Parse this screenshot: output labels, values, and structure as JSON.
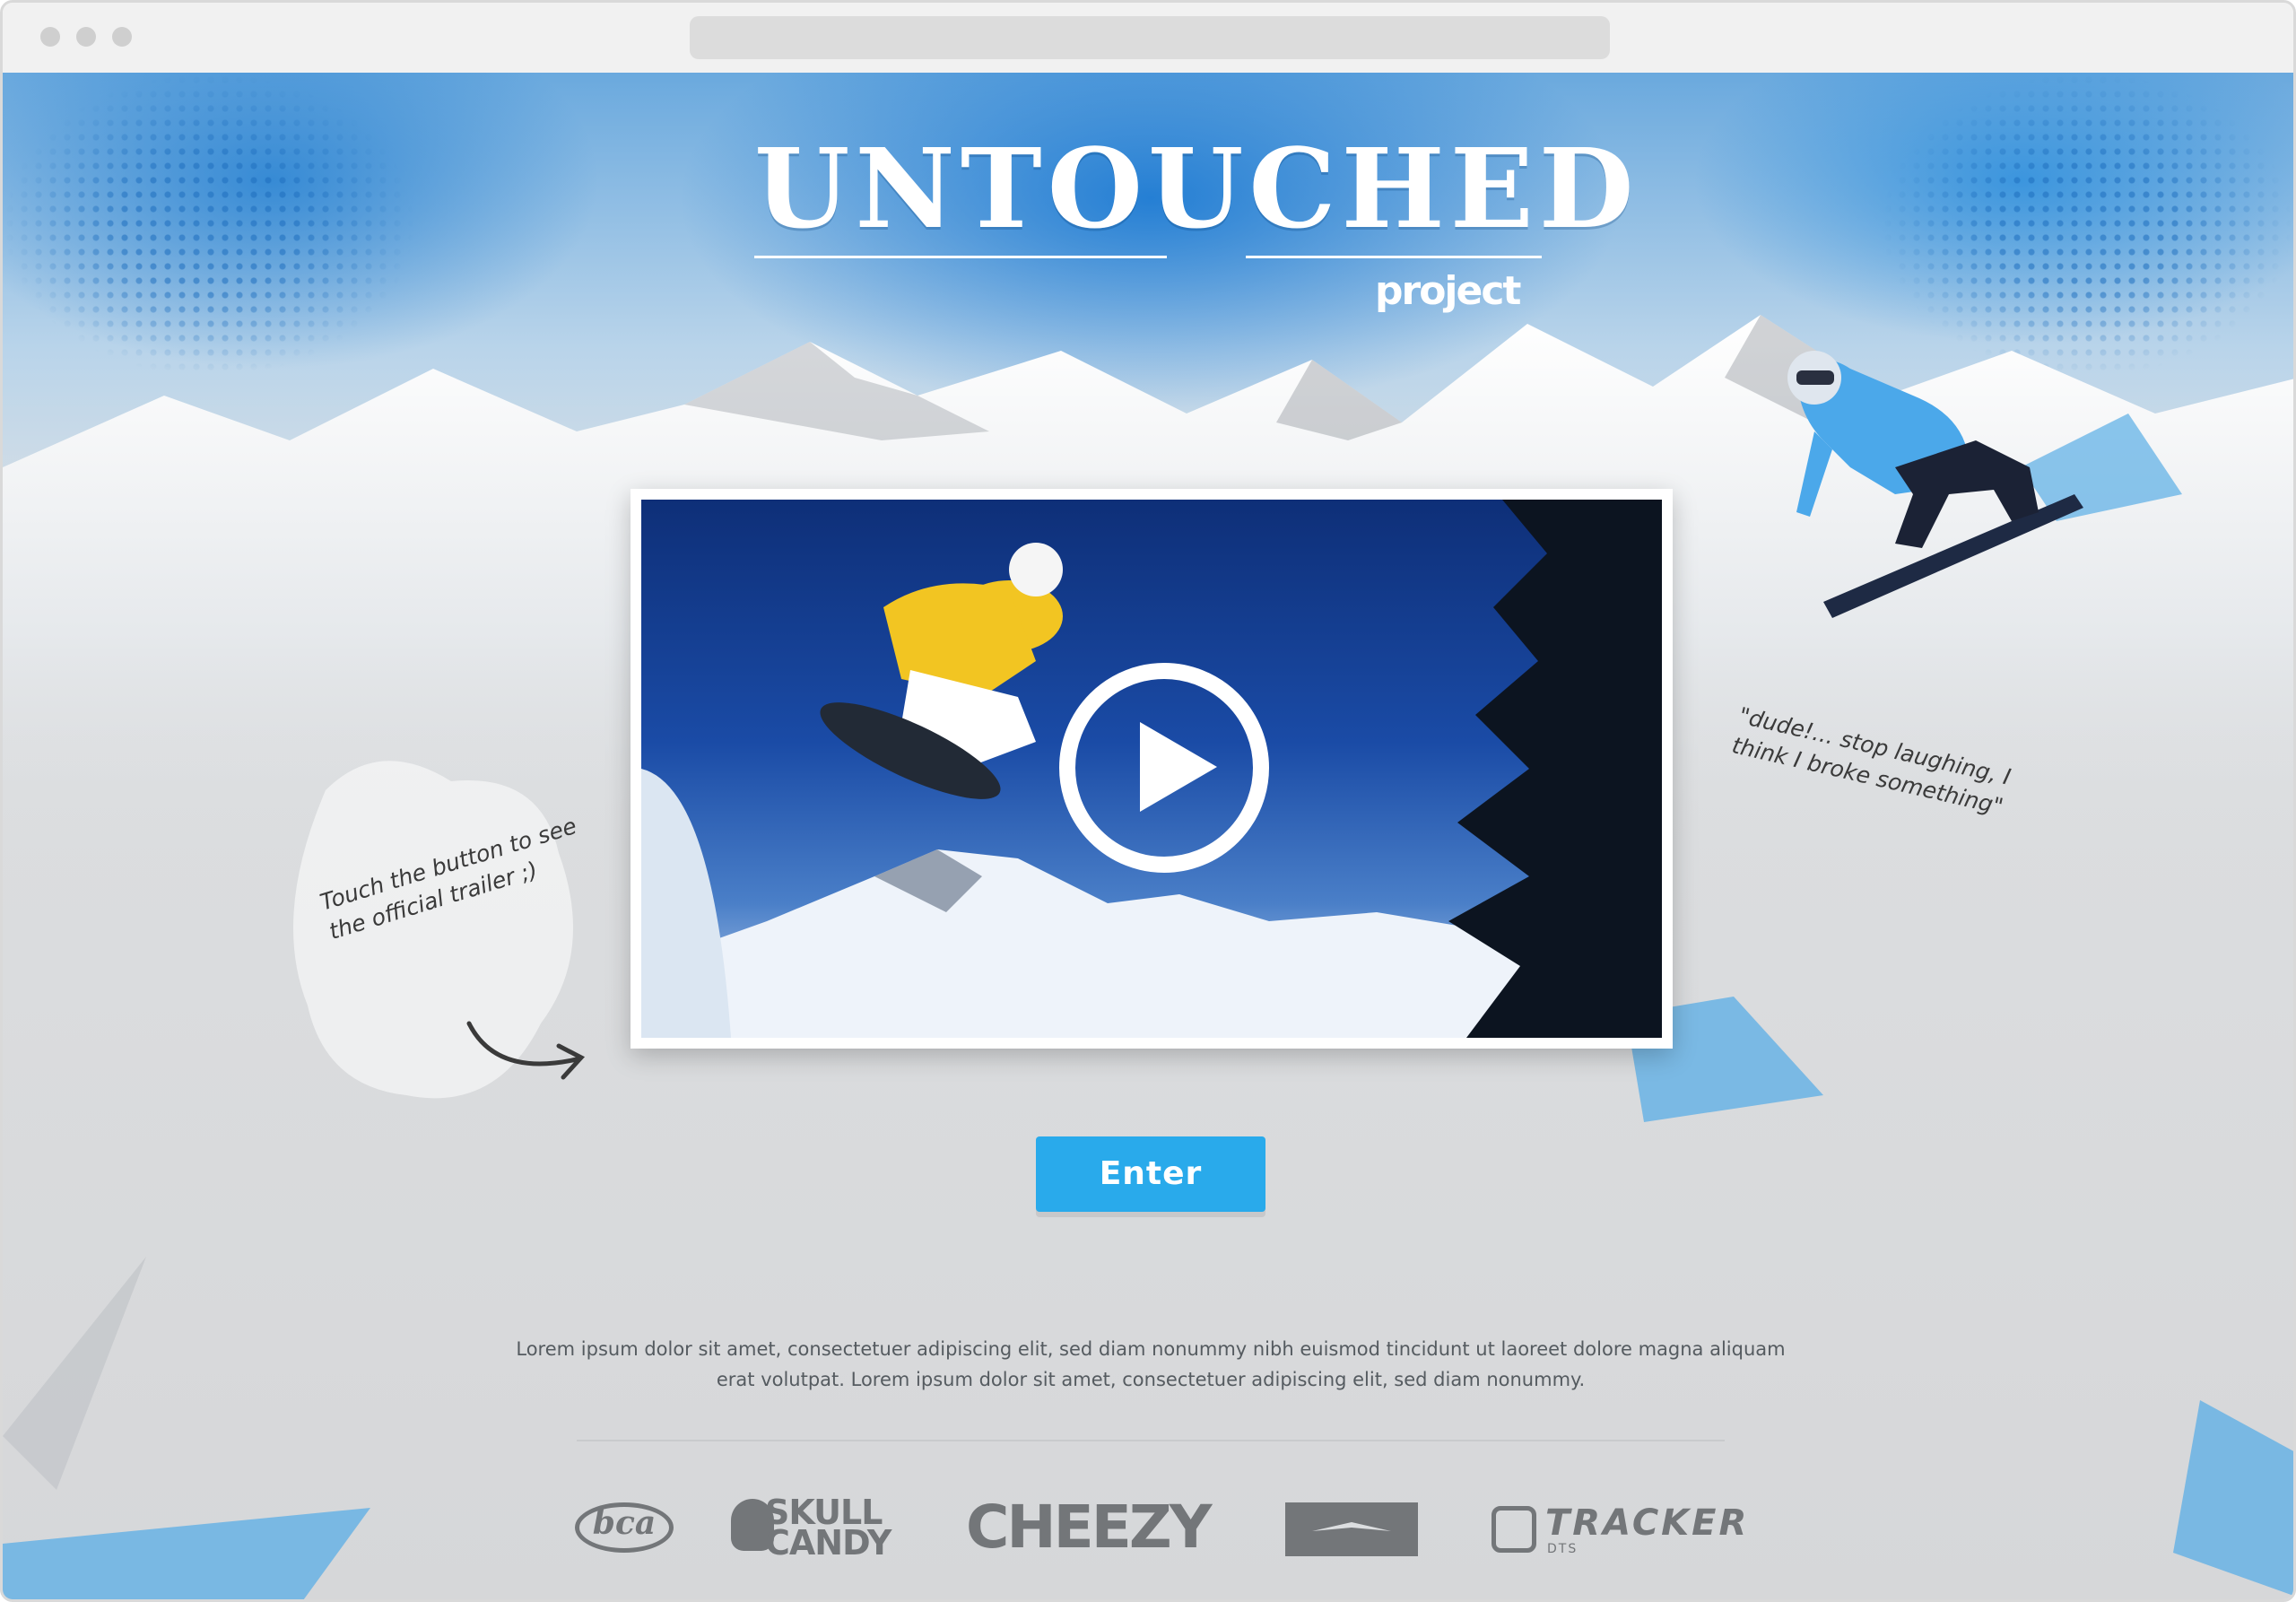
{
  "header": {
    "title": "UNTOUCHED",
    "subtitle": "project"
  },
  "notes": {
    "left": "Touch the button to see the official trailer ;)",
    "right": "\"dude!... stop laughing, I think I broke something\""
  },
  "video": {
    "play_icon": "play-circle-icon"
  },
  "cta": {
    "enter_label": "Enter"
  },
  "intro_text": "Lorem ipsum dolor sit amet, consectetuer adipiscing elit, sed diam nonummy nibh euismod tincidunt ut laoreet dolore magna aliquam erat volutpat. Lorem ipsum dolor sit amet, consectetuer adipiscing elit, sed diam nonummy.",
  "sponsors": {
    "bca": "bca",
    "skullcandy": "SKULL\nCANDY",
    "cheezy": "CHEEZY",
    "tracker": "TRACKER",
    "tracker_sub": "DTS"
  },
  "colors": {
    "accent": "#29aaeb",
    "sky_blue": "#1a7fd4",
    "logo_gray": "#737679"
  }
}
